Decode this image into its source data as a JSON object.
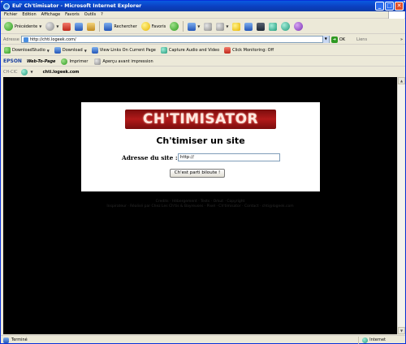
{
  "window": {
    "title": "Eul' Ch'timisator - Microsoft Internet Explorer",
    "icon": "ie-icon",
    "controls": {
      "minimize": "_",
      "maximize": "□",
      "close": "✕"
    }
  },
  "menu": [
    "Fichier",
    "Edition",
    "Affichage",
    "Favoris",
    "Outils",
    "?"
  ],
  "toolbar": {
    "back_label": "Précédente",
    "search_label": "Rechercher",
    "favorites_label": "Favoris"
  },
  "address": {
    "label": "Adresse",
    "url": "http://chti.logeek.com/",
    "go_label": "OK",
    "links_label": "Liens",
    "links_end": "»"
  },
  "toolbar2": {
    "download_studio": "DownloadStudio",
    "download": "Download",
    "view_links": "View Links On Current Page",
    "capture": "Capture Audio and Video",
    "click_monitoring": "Click Monitoring: Off"
  },
  "toolbar3": {
    "brand": "EPSON",
    "web_to_page": "Web-To-Page",
    "print": "Imprimer",
    "preview": "Aperçu avant impression"
  },
  "toolbar4": {
    "label": "CH-CIC",
    "domain": "chti.logeek.com"
  },
  "page": {
    "logo_text": "CH'TIMISATOR",
    "title": "Ch'timiser un site",
    "url_label": "Adresse du site :",
    "url_value": "http://",
    "submit_label": "Ch'est parti biloute !",
    "footer_line1": "Credits · Hébergement · Tests · Orkut · Copyright",
    "footer_line2": "Inspirateur · Réalisé par Chez Les Ch'tis & Bayreuses · Pixel · Ch'timisator · Contact · chti@logeek.com"
  },
  "status": {
    "left": "Terminé",
    "zone": "Internet"
  },
  "colors": {
    "titlebar": "#0b3fc0",
    "chrome": "#ece9d8",
    "page_background": "#000000",
    "card_background": "#ffffff",
    "logo_red": "#b21a1a"
  }
}
